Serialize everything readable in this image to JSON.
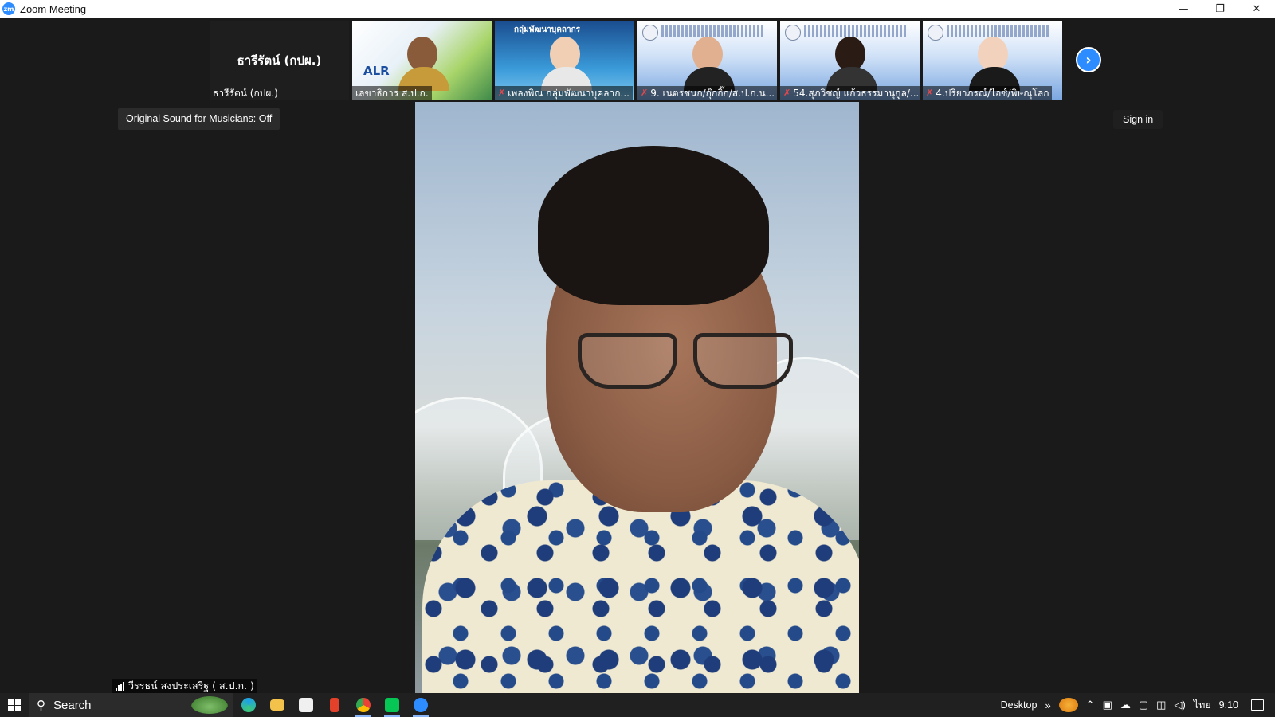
{
  "window": {
    "title": "Zoom Meeting",
    "app_icon_text": "zm",
    "controls": {
      "minimize": "—",
      "restore": "❐",
      "close": "✕"
    }
  },
  "gallery": {
    "tiles": [
      {
        "big_name": "ธารีรัตน์ (กปผ.)",
        "label": "ธารีรัตน์ (กปผ.)",
        "muted": false
      },
      {
        "label": "เลขาธิการ ส.ป.ก.",
        "logo_text": "ALR",
        "muted": false
      },
      {
        "label": "เพลงพิณ กลุ่มพัฒนาบุคลาก...",
        "banner": "กลุ่มพัฒนาบุคลากร",
        "muted": true
      },
      {
        "label": "9. เนตรชนก/กุ๊กกิ๊ก/ส.ป.ก.น...",
        "muted": true
      },
      {
        "label": "54.สุภวิชญ์ แก้วธรรมานุกูล/...",
        "muted": true
      },
      {
        "label": "4.ปริยาภรณ์/ไอซ์/พิษณุโลก",
        "muted": true
      }
    ],
    "next_icon": "›"
  },
  "original_sound": "Original Sound for Musicians: Off",
  "sign_in": "Sign in",
  "active_speaker": {
    "name": "วีรรธน์ สงประเสริฐ ( ส.ป.ก. )"
  },
  "taskbar": {
    "search_label": "Search",
    "search_icon": "⚲",
    "apps": [
      "edge",
      "file-explorer",
      "microsoft-store",
      "office",
      "chrome",
      "line",
      "zoom"
    ],
    "desktop_label": "Desktop",
    "overflow": "»",
    "input_language": "ไทย",
    "time": "9:10"
  }
}
